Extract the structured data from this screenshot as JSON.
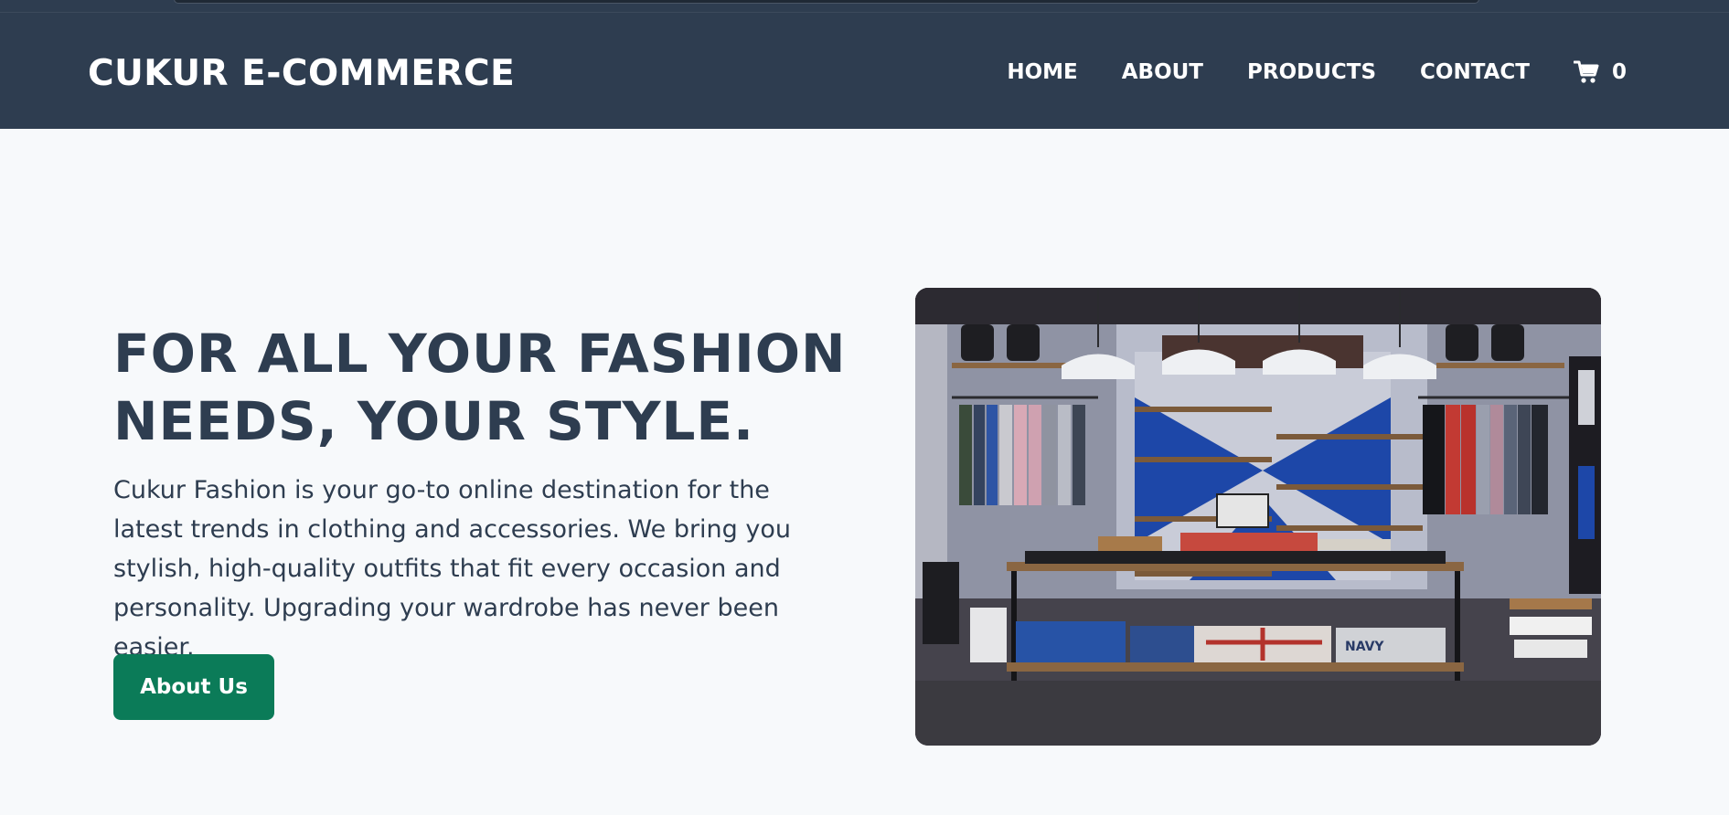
{
  "navbar": {
    "brand": "CUKUR E-COMMERCE",
    "links": [
      "HOME",
      "ABOUT",
      "PRODUCTS",
      "CONTACT"
    ],
    "cart": {
      "icon": "shopping-cart-icon",
      "count": "0"
    }
  },
  "hero": {
    "title": "FOR ALL YOUR FASHION NEEDS, YOUR STYLE.",
    "description": "Cukur Fashion is your go-to online destination for the latest trends in clothing and accessories. We bring you stylish, high-quality outfits that fit every occasion and personality. Upgrading your wardrobe has never been easier.",
    "button_label": "About Us",
    "image_label": "NAVY"
  },
  "colors": {
    "navbar_bg": "#2e3d50",
    "page_bg": "#f7f9fb",
    "heading": "#2e3d50",
    "button_bg": "#0b7b58"
  }
}
